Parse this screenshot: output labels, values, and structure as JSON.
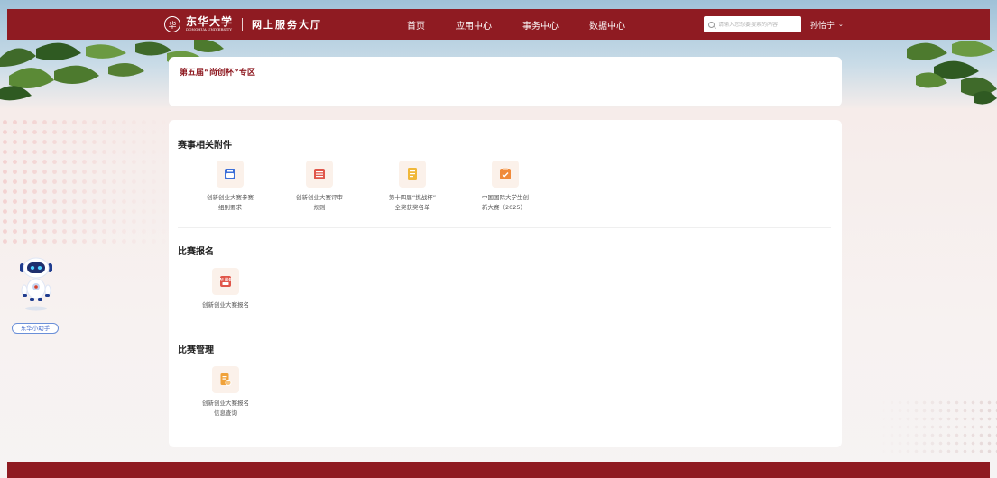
{
  "header": {
    "logo_seal": "华",
    "logo_text": "东华大学",
    "logo_subtext": "DONGHUA UNIVERSITY",
    "portal_title": "网上服务大厅",
    "nav": [
      "首页",
      "应用中心",
      "事务中心",
      "数据中心"
    ],
    "search_placeholder": "请输入您想要搜索的内容",
    "user_name": "孙怡宁",
    "user_chevron": "⌄"
  },
  "banner": {
    "title": "第五届“尚创杯”专区"
  },
  "sections": [
    {
      "title": "赛事相关附件",
      "items": [
        {
          "label_lines": [
            "创新创业大赛参赛",
            "组别要求"
          ],
          "icon": "folder-document-icon",
          "color": "#3d6fd8"
        },
        {
          "label_lines": [
            "创新创业大赛评审",
            "规则"
          ],
          "icon": "list-document-icon",
          "color": "#e0564a"
        },
        {
          "label_lines": [
            "第十四届“挑战杯”",
            "全奖获奖名单"
          ],
          "icon": "document-stack-icon",
          "color": "#f0b83a"
        },
        {
          "label_lines": [
            "中国国际大学生创",
            "新大赛（2025）···"
          ],
          "icon": "checklist-document-icon",
          "color": "#f08a3a"
        }
      ]
    },
    {
      "title": "比赛报名",
      "items": [
        {
          "label_lines": [
            "创新创业大赛报名"
          ],
          "icon": "ai-registration-icon",
          "color": "#e0564a",
          "badge": "AI 报名"
        }
      ]
    },
    {
      "title": "比赛管理",
      "items": [
        {
          "label_lines": [
            "创新创业大赛报名",
            "信息查询"
          ],
          "icon": "document-search-icon",
          "color": "#f0a23a"
        }
      ]
    }
  ],
  "assistant": {
    "label": "东华小助手",
    "icon": "robot-assistant-icon"
  },
  "colors": {
    "brand": "#8f1b22",
    "card_bg": "#ffffff",
    "assistant_accent": "#4a6fcc"
  }
}
